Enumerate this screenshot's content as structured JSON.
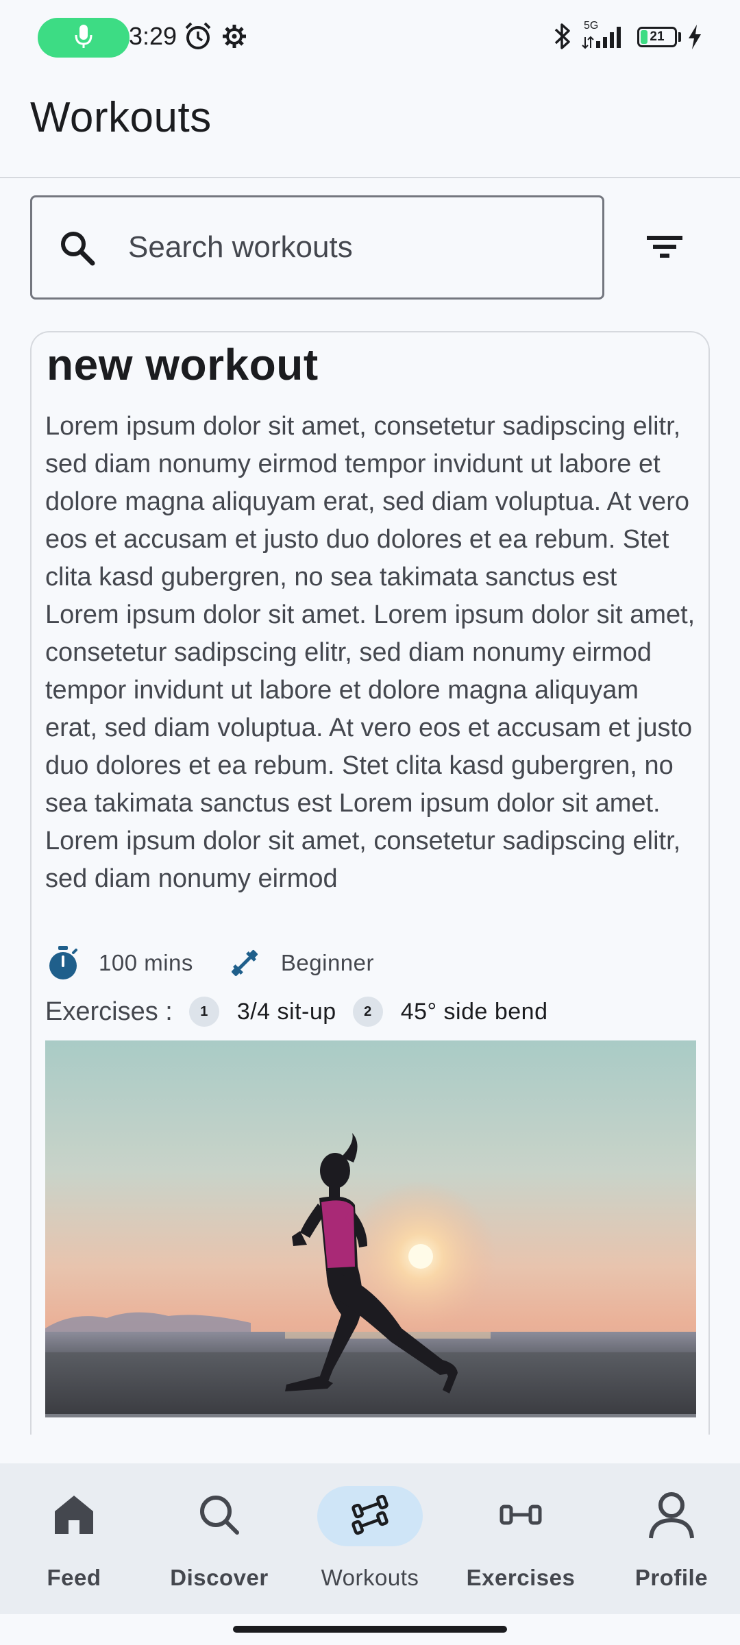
{
  "status_bar": {
    "time": "3:29",
    "battery_level": "21",
    "battery_fraction": 0.21,
    "network_label": "5G",
    "icons": [
      "mic-icon",
      "alarm-icon",
      "settings-gear-icon",
      "bluetooth-icon",
      "signal-icon",
      "battery-icon",
      "charging-bolt-icon"
    ]
  },
  "header": {
    "title": "Workouts"
  },
  "search": {
    "placeholder": "Search workouts",
    "value": ""
  },
  "workout_card": {
    "title": "new workout",
    "description": "Lorem ipsum dolor sit amet, consetetur sadipscing elitr, sed diam nonumy eirmod tempor invidunt ut labore et dolore magna aliquyam erat, sed diam voluptua. At vero eos et accusam et justo duo dolores et ea rebum. Stet clita kasd gubergren, no sea takimata sanctus est Lorem ipsum dolor sit amet. Lorem ipsum dolor sit amet, consetetur sadipscing elitr, sed diam nonumy eirmod tempor invidunt ut labore et dolore magna aliquyam erat, sed diam voluptua. At vero eos et accusam et justo duo dolores et ea rebum. Stet clita kasd gubergren, no sea takimata sanctus est Lorem ipsum dolor sit amet. Lorem ipsum dolor sit amet, consetetur sadipscing elitr, sed diam nonumy eirmod",
    "duration": "100 mins",
    "level": "Beginner",
    "exercises_label": "Exercises :",
    "exercises": [
      {
        "number": "1",
        "name": "3/4 sit-up"
      },
      {
        "number": "2",
        "name": "45° side bend"
      }
    ]
  },
  "bottom_nav": {
    "items": [
      {
        "label": "Feed",
        "icon": "home-icon",
        "active": false
      },
      {
        "label": "Discover",
        "icon": "search-icon",
        "active": false
      },
      {
        "label": "Workouts",
        "icon": "dumbbells-icon",
        "active": true
      },
      {
        "label": "Exercises",
        "icon": "dumbbell-icon",
        "active": false
      },
      {
        "label": "Profile",
        "icon": "person-icon",
        "active": false
      }
    ]
  },
  "colors": {
    "background": "#f7f9fc",
    "accent_green": "#3ddc84",
    "icon_blue": "#1f5f8b",
    "active_nav_pill": "#cfe5f7",
    "nav_background": "#e9edf2"
  }
}
